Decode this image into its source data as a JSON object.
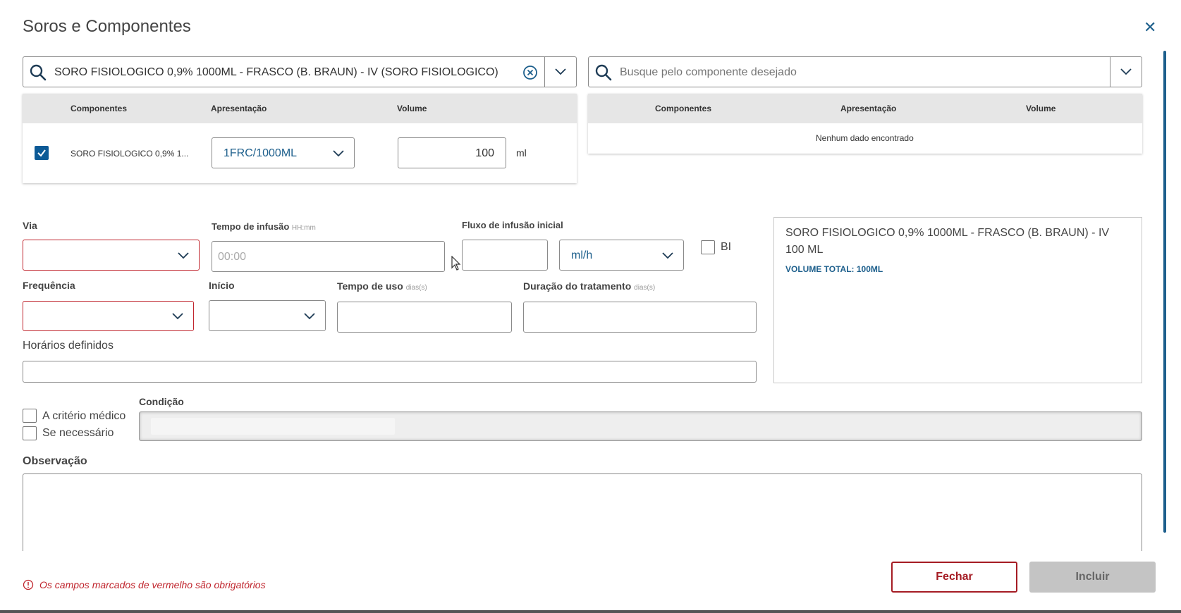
{
  "dialog": {
    "title": "Soros e Componentes",
    "close_icon": "close-icon"
  },
  "left_search": {
    "value": "SORO FISIOLOGICO 0,9% 1000ML - FRASCO (B. BRAUN) - IV (SORO FISIOLOGICO)"
  },
  "right_search": {
    "placeholder": "Busque pelo componente desejado"
  },
  "left_table": {
    "headers": [
      "Componentes",
      "Apresentação",
      "Volume"
    ],
    "rows": [
      {
        "checked": true,
        "component": "SORO FISIOLOGICO 0,9% 1...",
        "presentation": "1FRC/1000ML",
        "volume": "100",
        "unit": "ml"
      }
    ]
  },
  "right_table": {
    "headers": [
      "Componentes",
      "Apresentação",
      "Volume"
    ],
    "empty_message": "Nenhum dado encontrado"
  },
  "form": {
    "via_label": "Via",
    "via_value": "",
    "tempo_infusao_label": "Tempo de infusão",
    "tempo_infusao_hint": "HH:mm",
    "tempo_infusao_placeholder": "00:00",
    "fluxo_label": "Fluxo de infusão inicial",
    "fluxo_value": "",
    "fluxo_unit": "ml/h",
    "bi_label": "BI",
    "frequencia_label": "Frequência",
    "inicio_label": "Início",
    "tempo_uso_label": "Tempo de uso",
    "tempo_uso_hint": "dias(s)",
    "duracao_label": "Duração do tratamento",
    "duracao_hint": "dias(s)",
    "horarios_label": "Horários definidos",
    "criterio_medico_label": "A critério médico",
    "se_necessario_label": "Se necessário",
    "condicao_label": "Condição",
    "observacao_label": "Observação"
  },
  "summary": {
    "title": "SORO FISIOLOGICO 0,9% 1000ML - FRASCO (B. BRAUN) - IV 100 ML",
    "volume_total": "VOLUME TOTAL: 100ML"
  },
  "footer": {
    "required_message": "Os campos marcados de vermelho são obrigatórios",
    "fechar_label": "Fechar",
    "incluir_label": "Incluir"
  },
  "colors": {
    "accent": "#0c5a96",
    "required": "#c0252d",
    "fechar": "#a51c24",
    "incluir_disabled": "#c4c4c4"
  }
}
